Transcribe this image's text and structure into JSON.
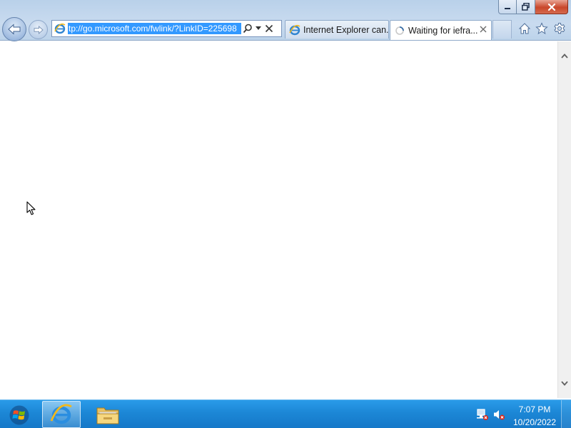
{
  "window": {
    "caption_buttons": [
      "minimize",
      "maximize",
      "close"
    ]
  },
  "nav": {
    "back_icon": "back-arrow-icon",
    "forward_icon": "forward-arrow-icon"
  },
  "address_bar": {
    "url": "tp://go.microsoft.com/fwlink/?LinkID=225698",
    "favicon": "ie-icon",
    "search_icon": "search-icon",
    "dropdown_icon": "chevron-down-icon",
    "stop_icon": "close-icon"
  },
  "tabs": [
    {
      "label": "Internet Explorer can...",
      "icon": "ie-icon",
      "active": false
    },
    {
      "label": "Waiting for iefra...",
      "icon": "loading-spinner-icon",
      "active": true
    }
  ],
  "toolbar_icons": [
    "home-icon",
    "favorites-star-icon",
    "tools-gear-icon"
  ],
  "taskbar": {
    "apps": [
      "internet-explorer",
      "windows-explorer"
    ],
    "tray_icons": [
      "network-icon",
      "volume-muted-icon"
    ],
    "clock": {
      "time": "7:07 PM",
      "date": "10/20/2022"
    }
  },
  "colors": {
    "taskbar": "#1c87d6",
    "chrome": "#c9dbef",
    "url_highlight": "#3399ff",
    "close_button": "#c9472a"
  }
}
